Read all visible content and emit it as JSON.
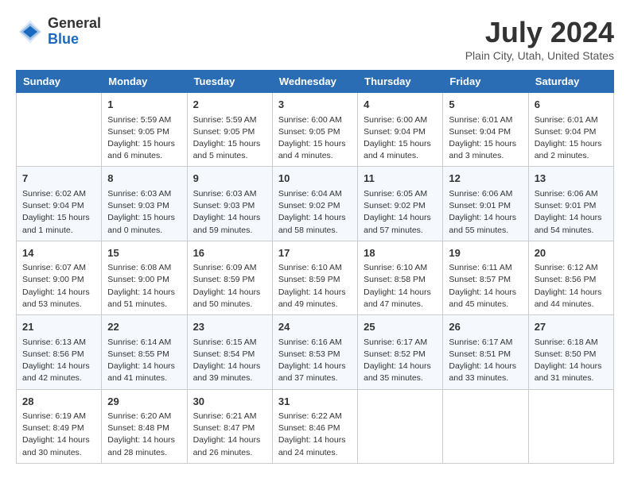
{
  "header": {
    "logo_general": "General",
    "logo_blue": "Blue",
    "month": "July 2024",
    "location": "Plain City, Utah, United States"
  },
  "weekdays": [
    "Sunday",
    "Monday",
    "Tuesday",
    "Wednesday",
    "Thursday",
    "Friday",
    "Saturday"
  ],
  "weeks": [
    [
      {
        "day": "",
        "info": ""
      },
      {
        "day": "1",
        "info": "Sunrise: 5:59 AM\nSunset: 9:05 PM\nDaylight: 15 hours\nand 6 minutes."
      },
      {
        "day": "2",
        "info": "Sunrise: 5:59 AM\nSunset: 9:05 PM\nDaylight: 15 hours\nand 5 minutes."
      },
      {
        "day": "3",
        "info": "Sunrise: 6:00 AM\nSunset: 9:05 PM\nDaylight: 15 hours\nand 4 minutes."
      },
      {
        "day": "4",
        "info": "Sunrise: 6:00 AM\nSunset: 9:04 PM\nDaylight: 15 hours\nand 4 minutes."
      },
      {
        "day": "5",
        "info": "Sunrise: 6:01 AM\nSunset: 9:04 PM\nDaylight: 15 hours\nand 3 minutes."
      },
      {
        "day": "6",
        "info": "Sunrise: 6:01 AM\nSunset: 9:04 PM\nDaylight: 15 hours\nand 2 minutes."
      }
    ],
    [
      {
        "day": "7",
        "info": "Sunrise: 6:02 AM\nSunset: 9:04 PM\nDaylight: 15 hours\nand 1 minute."
      },
      {
        "day": "8",
        "info": "Sunrise: 6:03 AM\nSunset: 9:03 PM\nDaylight: 15 hours\nand 0 minutes."
      },
      {
        "day": "9",
        "info": "Sunrise: 6:03 AM\nSunset: 9:03 PM\nDaylight: 14 hours\nand 59 minutes."
      },
      {
        "day": "10",
        "info": "Sunrise: 6:04 AM\nSunset: 9:02 PM\nDaylight: 14 hours\nand 58 minutes."
      },
      {
        "day": "11",
        "info": "Sunrise: 6:05 AM\nSunset: 9:02 PM\nDaylight: 14 hours\nand 57 minutes."
      },
      {
        "day": "12",
        "info": "Sunrise: 6:06 AM\nSunset: 9:01 PM\nDaylight: 14 hours\nand 55 minutes."
      },
      {
        "day": "13",
        "info": "Sunrise: 6:06 AM\nSunset: 9:01 PM\nDaylight: 14 hours\nand 54 minutes."
      }
    ],
    [
      {
        "day": "14",
        "info": "Sunrise: 6:07 AM\nSunset: 9:00 PM\nDaylight: 14 hours\nand 53 minutes."
      },
      {
        "day": "15",
        "info": "Sunrise: 6:08 AM\nSunset: 9:00 PM\nDaylight: 14 hours\nand 51 minutes."
      },
      {
        "day": "16",
        "info": "Sunrise: 6:09 AM\nSunset: 8:59 PM\nDaylight: 14 hours\nand 50 minutes."
      },
      {
        "day": "17",
        "info": "Sunrise: 6:10 AM\nSunset: 8:59 PM\nDaylight: 14 hours\nand 49 minutes."
      },
      {
        "day": "18",
        "info": "Sunrise: 6:10 AM\nSunset: 8:58 PM\nDaylight: 14 hours\nand 47 minutes."
      },
      {
        "day": "19",
        "info": "Sunrise: 6:11 AM\nSunset: 8:57 PM\nDaylight: 14 hours\nand 45 minutes."
      },
      {
        "day": "20",
        "info": "Sunrise: 6:12 AM\nSunset: 8:56 PM\nDaylight: 14 hours\nand 44 minutes."
      }
    ],
    [
      {
        "day": "21",
        "info": "Sunrise: 6:13 AM\nSunset: 8:56 PM\nDaylight: 14 hours\nand 42 minutes."
      },
      {
        "day": "22",
        "info": "Sunrise: 6:14 AM\nSunset: 8:55 PM\nDaylight: 14 hours\nand 41 minutes."
      },
      {
        "day": "23",
        "info": "Sunrise: 6:15 AM\nSunset: 8:54 PM\nDaylight: 14 hours\nand 39 minutes."
      },
      {
        "day": "24",
        "info": "Sunrise: 6:16 AM\nSunset: 8:53 PM\nDaylight: 14 hours\nand 37 minutes."
      },
      {
        "day": "25",
        "info": "Sunrise: 6:17 AM\nSunset: 8:52 PM\nDaylight: 14 hours\nand 35 minutes."
      },
      {
        "day": "26",
        "info": "Sunrise: 6:17 AM\nSunset: 8:51 PM\nDaylight: 14 hours\nand 33 minutes."
      },
      {
        "day": "27",
        "info": "Sunrise: 6:18 AM\nSunset: 8:50 PM\nDaylight: 14 hours\nand 31 minutes."
      }
    ],
    [
      {
        "day": "28",
        "info": "Sunrise: 6:19 AM\nSunset: 8:49 PM\nDaylight: 14 hours\nand 30 minutes."
      },
      {
        "day": "29",
        "info": "Sunrise: 6:20 AM\nSunset: 8:48 PM\nDaylight: 14 hours\nand 28 minutes."
      },
      {
        "day": "30",
        "info": "Sunrise: 6:21 AM\nSunset: 8:47 PM\nDaylight: 14 hours\nand 26 minutes."
      },
      {
        "day": "31",
        "info": "Sunrise: 6:22 AM\nSunset: 8:46 PM\nDaylight: 14 hours\nand 24 minutes."
      },
      {
        "day": "",
        "info": ""
      },
      {
        "day": "",
        "info": ""
      },
      {
        "day": "",
        "info": ""
      }
    ]
  ]
}
